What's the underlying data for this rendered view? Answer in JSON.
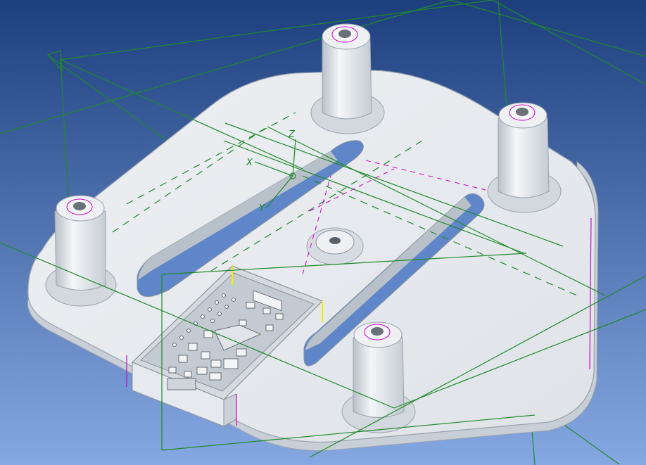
{
  "viewport": {
    "type": "cad-3d-model-view",
    "background_top": "#1d3f7e",
    "background_bottom": "#86a8e2",
    "part_color": "#e9ebee",
    "part_edge_color": "#9aa3ad",
    "datum_color": "#1e8a2a",
    "highlight_edge_color": "#d000d0",
    "selection_color": "#f0f000",
    "axis_labels": [
      "X",
      "Y",
      "Z"
    ]
  },
  "model": {
    "standoffs": 4,
    "center_boss": 1,
    "slots": 2,
    "pcb_pocket": 1
  }
}
